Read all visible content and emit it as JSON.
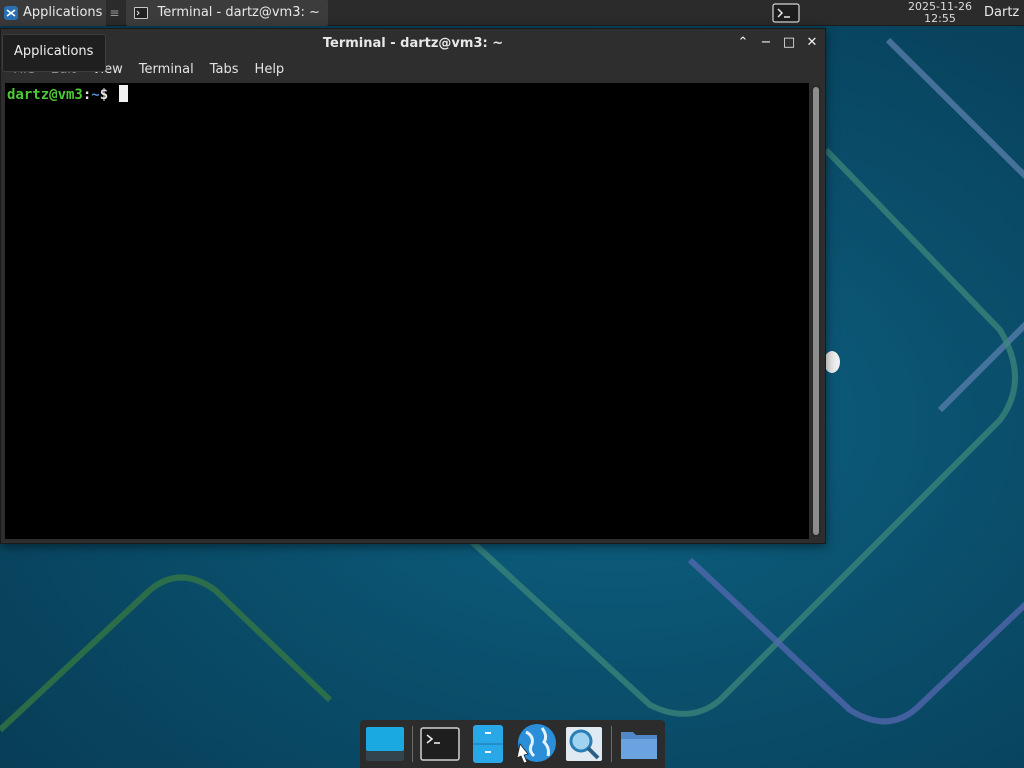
{
  "top_panel": {
    "apps_label": "Applications",
    "task_title": "Terminal - dartz@vm3: ~",
    "clock_date": "2025-11-26",
    "clock_time": "12:55",
    "user": "Dartz"
  },
  "tooltip": {
    "text": "Applications"
  },
  "window": {
    "title": "Terminal - dartz@vm3: ~",
    "menu": [
      "File",
      "Edit",
      "View",
      "Terminal",
      "Tabs",
      "Help"
    ],
    "buttons": {
      "shade": "⌃",
      "minimize": "−",
      "maximize": "□",
      "close": "✕"
    }
  },
  "terminal": {
    "prompt_user": "dartz@vm3",
    "prompt_sep": ":",
    "prompt_path": "~",
    "prompt_symbol": "$"
  },
  "colors": {
    "prompt_user": "#4ec936",
    "prompt_path": "#4e8fd8",
    "desktop_bg": "#0a4f6c",
    "panel_bg": "#2b2b2b"
  },
  "dock": {
    "items": [
      "show-desktop",
      "terminal",
      "file-manager-drawer",
      "web-browser",
      "app-finder",
      "home-folder"
    ]
  }
}
